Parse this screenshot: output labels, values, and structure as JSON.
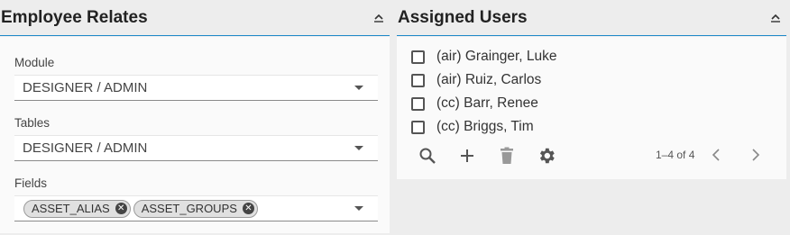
{
  "left_panel": {
    "title": "Employee Relates",
    "collapse_icon": "chevron-up-icon",
    "module": {
      "label": "Module",
      "value": "DESIGNER / ADMIN"
    },
    "tables": {
      "label": "Tables",
      "value": "DESIGNER / ADMIN"
    },
    "fields": {
      "label": "Fields",
      "chips": [
        "ASSET_ALIAS",
        "ASSET_GROUPS"
      ]
    }
  },
  "right_panel": {
    "title": "Assigned Users",
    "collapse_icon": "chevron-up-icon",
    "users": [
      "(air) Grainger, Luke",
      "(air) Ruiz, Carlos",
      "(cc) Barr, Renee",
      "(cc) Briggs, Tim"
    ],
    "toolbar": [
      "search-icon",
      "add-icon",
      "delete-icon",
      "settings-icon"
    ],
    "pagination": {
      "range": "1–4 of 4"
    }
  },
  "colors": {
    "accent": "#1e88c8",
    "icon": "#555555"
  }
}
